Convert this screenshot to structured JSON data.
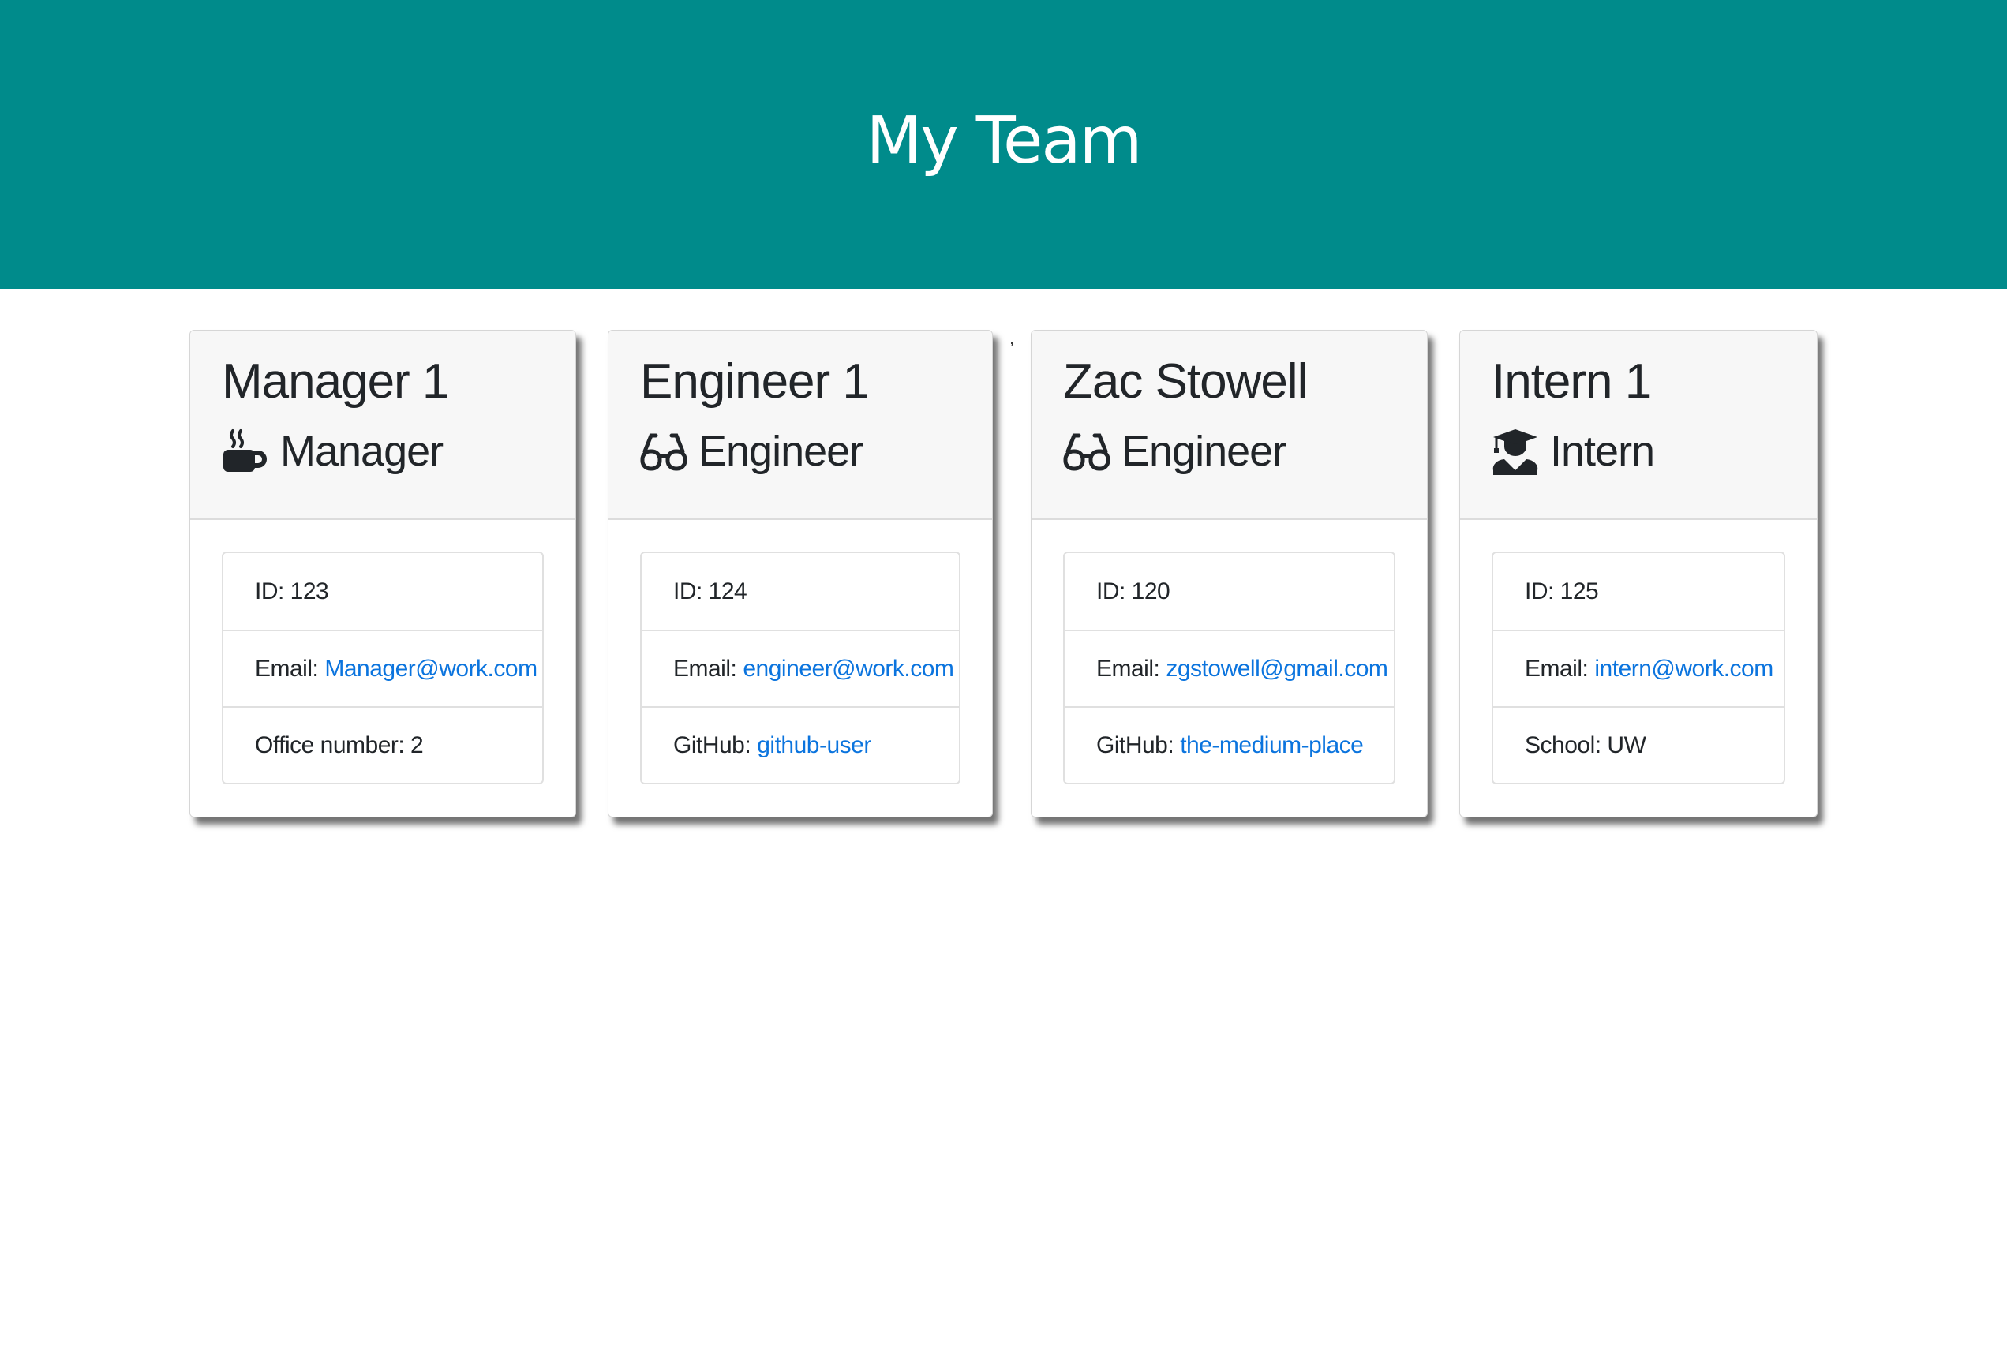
{
  "header": {
    "title": "My Team"
  },
  "stray_mark": ",",
  "cards": [
    {
      "name": "Manager 1",
      "role": "Manager",
      "icon": "coffee-mug-icon",
      "rows": [
        {
          "label": "ID: 123",
          "link": ""
        },
        {
          "label": "Email:",
          "link": "Manager@work.com"
        },
        {
          "label": "Office number: 2",
          "link": ""
        }
      ]
    },
    {
      "name": "Engineer 1",
      "role": "Engineer",
      "icon": "glasses-icon",
      "rows": [
        {
          "label": "ID: 124",
          "link": ""
        },
        {
          "label": "Email:",
          "link": "engineer@work.com"
        },
        {
          "label": "GitHub:",
          "link": "github-user"
        }
      ]
    },
    {
      "name": "Zac Stowell",
      "role": "Engineer",
      "icon": "glasses-icon",
      "rows": [
        {
          "label": "ID: 120",
          "link": ""
        },
        {
          "label": "Email:",
          "link": "zgstowell@gmail.com"
        },
        {
          "label": "GitHub:",
          "link": "the-medium-place"
        }
      ]
    },
    {
      "name": "Intern 1",
      "role": "Intern",
      "icon": "graduate-icon",
      "rows": [
        {
          "label": "ID: 125",
          "link": ""
        },
        {
          "label": "Email:",
          "link": "intern@work.com"
        },
        {
          "label": "School: UW",
          "link": ""
        }
      ]
    }
  ],
  "colors": {
    "header_bg": "#008b8b",
    "link": "#0b74de"
  }
}
